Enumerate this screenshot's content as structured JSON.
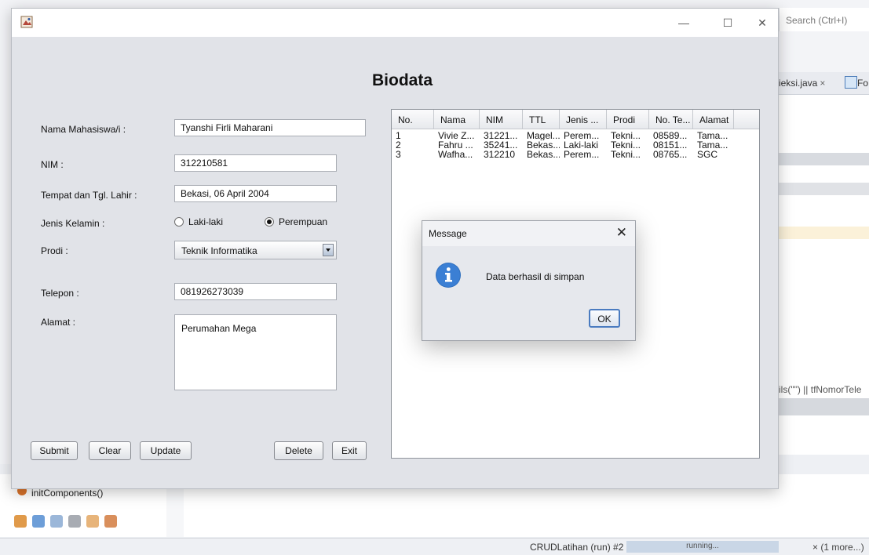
{
  "ide": {
    "search_placeholder": "Search (Ctrl+I)",
    "tab_file": "ieksi.java",
    "tab_close": "×",
    "tab_form": "Fo",
    "code_fragment": "ils(\"\") || tfNomorTele",
    "navigator_item": "initComponents()",
    "status_run": "CRUDLatihan (run) #2",
    "status_progress_label": "running...",
    "status_more": "×  (1 more...)"
  },
  "window": {
    "minimize": "—",
    "maximize": "☐",
    "close": "✕"
  },
  "form": {
    "title": "Biodata",
    "labels": {
      "nama": "Nama Mahasiswa/i :",
      "nim": "NIM :",
      "ttl": "Tempat dan Tgl. Lahir :",
      "jenis_kelamin": "Jenis Kelamin :",
      "prodi": "Prodi :",
      "telepon": "Telepon :",
      "alamat": "Alamat :"
    },
    "values": {
      "nama": "Tyanshi Firli Maharani",
      "nim": "312210581",
      "ttl": "Bekasi, 06 April 2004",
      "telepon": "081926273039",
      "alamat": "Perumahan Mega",
      "prodi_selected": "Teknik Informatika"
    },
    "gender_options": {
      "male": "Laki-laki",
      "female": "Perempuan",
      "selected": "Perempuan"
    },
    "buttons": {
      "submit": "Submit",
      "clear": "Clear",
      "update": "Update",
      "delete": "Delete",
      "exit": "Exit"
    }
  },
  "table": {
    "columns": [
      "No.",
      "Nama",
      "NIM",
      "TTL",
      "Jenis ...",
      "Prodi",
      "No. Te...",
      "Alamat"
    ],
    "rows": [
      [
        "1",
        "Vivie Z...",
        "31221...",
        "Magel...",
        "Perem...",
        "Tekni...",
        "08589...",
        "Tama..."
      ],
      [
        "2",
        "Fahru ...",
        "35241...",
        "Bekas...",
        "Laki-laki",
        "Tekni...",
        "08151...",
        "Tama..."
      ],
      [
        "3",
        "Wafha...",
        "312210",
        "Bekas...",
        "Perem...",
        "Tekni...",
        "08765...",
        "SGC"
      ]
    ]
  },
  "dialog": {
    "title": "Message",
    "close": "✕",
    "message": "Data berhasil di simpan",
    "ok_label": "OK"
  }
}
